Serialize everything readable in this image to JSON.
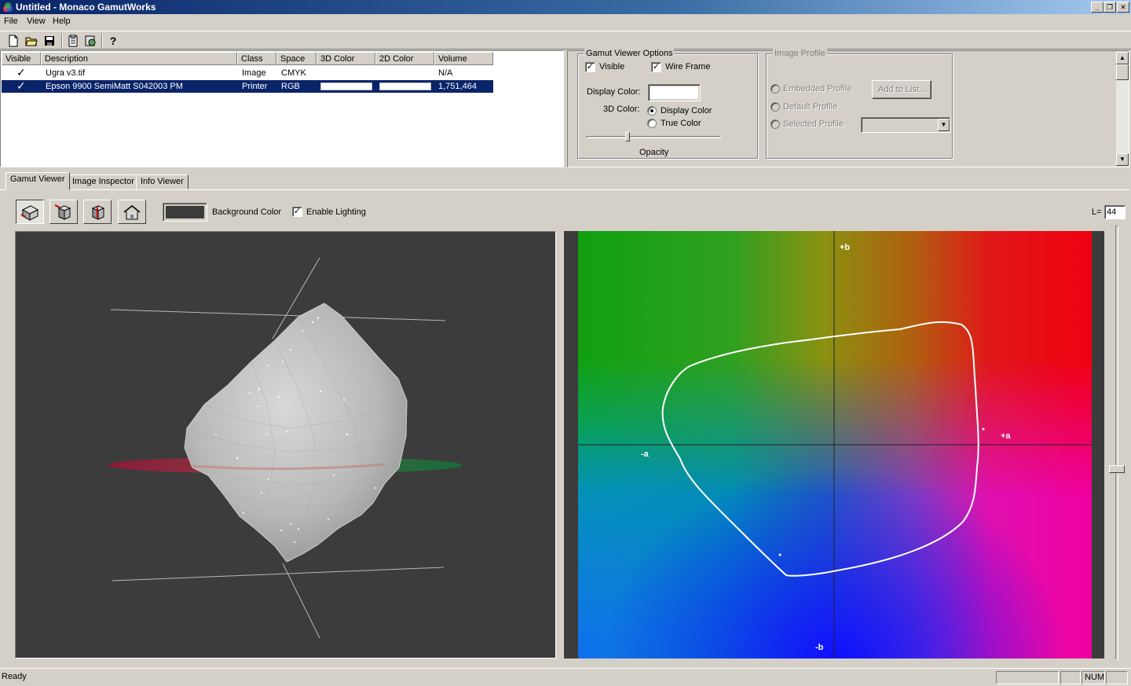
{
  "window": {
    "title": "Untitled - Monaco GamutWorks"
  },
  "menu": [
    "File",
    "View",
    "Help"
  ],
  "list": {
    "columns": [
      "Visible",
      "Description",
      "Class",
      "Space",
      "3D Color",
      "2D Color",
      "Volume"
    ],
    "rows": [
      {
        "visible": true,
        "description": "Ugra v3.tif",
        "class": "Image",
        "space": "CMYK",
        "color3d": "",
        "color2d": "",
        "volume": "N/A",
        "selected": false
      },
      {
        "visible": true,
        "description": "Epson 9900 SemiMatt S042003 PM",
        "class": "Printer",
        "space": "RGB",
        "color3d": "#ffffff",
        "color2d": "#ffffff",
        "volume": "1,751,464",
        "selected": true
      }
    ]
  },
  "gamut_options": {
    "title": "Gamut Viewer Options",
    "visible_label": "Visible",
    "visible_checked": true,
    "wireframe_label": "Wire Frame",
    "wireframe_checked": true,
    "display_color_label": "Display Color:",
    "display_color_value": "#ffffff",
    "color3d_label": "3D Color:",
    "color3d_options": [
      "Display Color",
      "True Color"
    ],
    "color3d_selected": "Display Color",
    "opacity_label": "Opacity"
  },
  "image_profile": {
    "title": "Image Profile",
    "options": [
      "Embedded Profile",
      "Default Profile",
      "Selected Profile"
    ],
    "add_button": "Add to List..."
  },
  "tabs": [
    "Gamut Viewer",
    "Image Inspector",
    "Info Viewer"
  ],
  "active_tab": "Gamut Viewer",
  "viewer": {
    "tool_icons": [
      "rotate-view-icon",
      "cube-view-icon",
      "slice-view-icon",
      "home-view-icon"
    ],
    "background_color_label": "Background Color",
    "background_color_value": "#3c3c3c",
    "enable_lighting_label": "Enable Lighting",
    "enable_lighting_checked": true,
    "l_label": "L=",
    "l_value": "44"
  },
  "plot2d": {
    "labels": {
      "plus_b": "+b",
      "minus_b": "-b",
      "plus_a": "+a",
      "minus_a": "-a"
    }
  },
  "status": {
    "text": "Ready",
    "num": "NUM"
  }
}
